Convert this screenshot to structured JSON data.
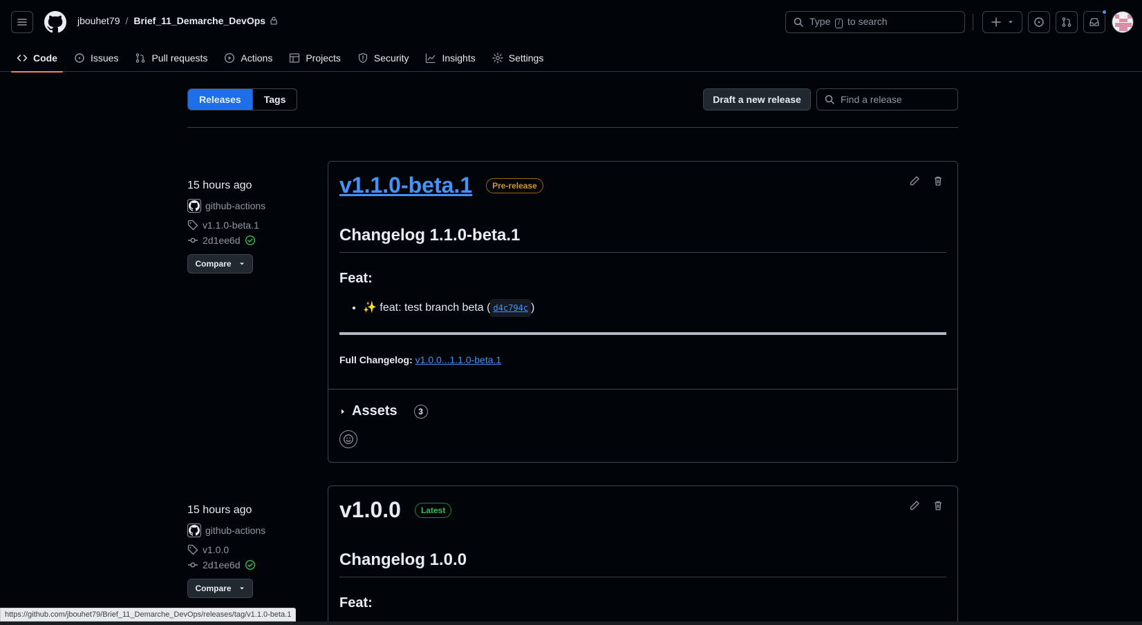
{
  "header": {
    "owner": "jbouhet79",
    "separator": "/",
    "repo": "Brief_11_Demarche_DevOps",
    "search_before": "Type",
    "search_key": "/",
    "search_after": "to search",
    "plus_label": "+",
    "icons": [
      "hamburger-icon",
      "github-logo-icon",
      "lock-icon",
      "search-icon",
      "plus-icon",
      "issues-icon",
      "pull-request-icon",
      "inbox-icon",
      "avatar"
    ]
  },
  "nav": [
    {
      "label": "Code",
      "icon": "code-icon",
      "active": true
    },
    {
      "label": "Issues",
      "icon": "issue-opened-icon"
    },
    {
      "label": "Pull requests",
      "icon": "git-pull-request-icon"
    },
    {
      "label": "Actions",
      "icon": "play-icon"
    },
    {
      "label": "Projects",
      "icon": "table-icon"
    },
    {
      "label": "Security",
      "icon": "shield-icon"
    },
    {
      "label": "Insights",
      "icon": "graph-icon"
    },
    {
      "label": "Settings",
      "icon": "gear-icon"
    }
  ],
  "subnav": {
    "releases": "Releases",
    "tags": "Tags",
    "draft": "Draft a new release",
    "find_placeholder": "Find a release"
  },
  "releases": [
    {
      "time": "15 hours ago",
      "author": "github-actions",
      "tag": "v1.1.0-beta.1",
      "commit": "2d1ee6d",
      "compare": "Compare",
      "title": "v1.1.0-beta.1",
      "badge": "Pre-release",
      "changelog_heading": "Changelog 1.1.0-beta.1",
      "section": "Feat:",
      "item_emoji": "✨",
      "item_text": "feat: test branch beta (",
      "item_sha": "d4c794c",
      "item_close": ")",
      "full_changelog_label": "Full Changelog:",
      "full_changelog_link": "v1.0.0...1.1.0-beta.1",
      "assets_label": "Assets",
      "assets_count": "3"
    },
    {
      "time": "15 hours ago",
      "author": "github-actions",
      "tag": "v1.0.0",
      "commit": "2d1ee6d",
      "compare": "Compare",
      "title": "v1.0.0",
      "badge": "Latest",
      "changelog_heading": "Changelog 1.0.0",
      "section": "Feat:"
    }
  ],
  "status_url": "https://github.com/jbouhet79/Brief_11_Demarche_DevOps/releases/tag/v1.1.0-beta.1",
  "colors": {
    "background": "#010409",
    "border": "#3d444d",
    "accent": "#1f6feb",
    "link": "#4493f8",
    "prerelease": "#d29922",
    "latest": "#3fb950",
    "active_tab_underline": "#f78166"
  }
}
